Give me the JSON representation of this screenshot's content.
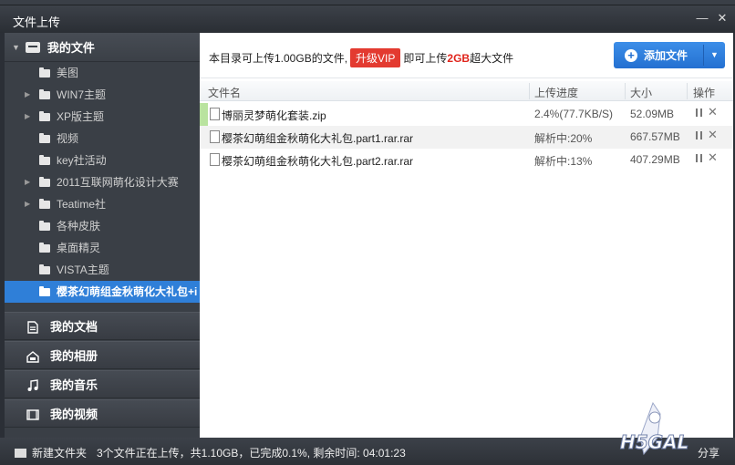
{
  "window": {
    "title": "文件上传",
    "minimize_label": "—",
    "close_label": "✕"
  },
  "sidebar": {
    "header": {
      "label": "我的文件"
    },
    "folders": [
      {
        "label": "美图",
        "expandable": false
      },
      {
        "label": "WIN7主题",
        "expandable": true
      },
      {
        "label": "XP版主题",
        "expandable": true
      },
      {
        "label": "视频",
        "expandable": false
      },
      {
        "label": "key社活动",
        "expandable": false
      },
      {
        "label": "2011互联网萌化设计大赛",
        "expandable": true
      },
      {
        "label": "Teatime社",
        "expandable": true
      },
      {
        "label": "各种皮肤",
        "expandable": false
      },
      {
        "label": "桌面精灵",
        "expandable": false
      },
      {
        "label": "VISTA主题",
        "expandable": false
      },
      {
        "label": "樱茶幻萌组金秋萌化大礼包+i",
        "expandable": false,
        "selected": true
      }
    ],
    "categories": [
      {
        "label": "我的文档",
        "icon": "document-icon"
      },
      {
        "label": "我的相册",
        "icon": "photo-album-icon"
      },
      {
        "label": "我的音乐",
        "icon": "music-icon"
      },
      {
        "label": "我的视频",
        "icon": "video-icon"
      }
    ]
  },
  "info": {
    "prefix": "本目录可上传1.00GB的文件,",
    "vip_button": "升级VIP",
    "middle": "即可上传",
    "highlight": "2GB",
    "suffix": "超大文件"
  },
  "add_button": {
    "label": "添加文件"
  },
  "table": {
    "headers": {
      "name": "文件名",
      "progress": "上传进度",
      "size": "大小",
      "action": "操作"
    },
    "rows": [
      {
        "name": "博丽灵梦萌化套装.zip",
        "progress": "2.4%(77.7KB/S)",
        "size": "52.09MB",
        "progress_fraction": 0.024
      },
      {
        "name": "樱茶幻萌组金秋萌化大礼包.part1.rar.rar",
        "progress": "解析中:20%",
        "size": "667.57MB"
      },
      {
        "name": "樱茶幻萌组金秋萌化大礼包.part2.rar.rar",
        "progress": "解析中:13%",
        "size": "407.29MB"
      }
    ]
  },
  "statusbar": {
    "new_folder": "新建文件夹",
    "status": "3个文件正在上传，共1.10GB，已完成0.1%, 剩余时间: 04:01:23",
    "share": "分享"
  },
  "watermark": {
    "text": "H5GAL"
  },
  "colors": {
    "accent": "#2f7fd8",
    "vip": "#e33a30",
    "highlight": "#e0241b",
    "progress": "#b9e39f"
  }
}
